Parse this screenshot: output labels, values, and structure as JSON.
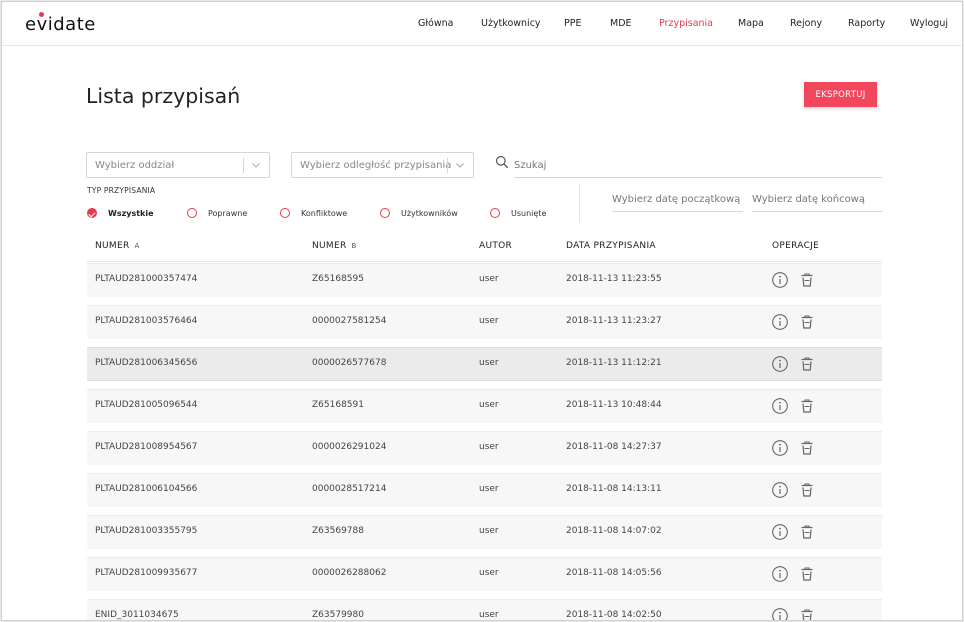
{
  "header": {
    "logo": "evidate",
    "nav": [
      {
        "label": "Główna",
        "active": false
      },
      {
        "label": "Użytkownicy",
        "active": false
      },
      {
        "label": "PPE",
        "active": false
      },
      {
        "label": "MDE",
        "active": false
      },
      {
        "label": "Przypisania",
        "active": true
      },
      {
        "label": "Mapa",
        "active": false
      },
      {
        "label": "Rejony",
        "active": false
      },
      {
        "label": "Raporty",
        "active": false
      },
      {
        "label": "Wyloguj",
        "active": false
      }
    ]
  },
  "page": {
    "title": "Lista przypisań",
    "export_label": "EKSPORTUJ"
  },
  "filters": {
    "branch_placeholder": "Wybierz oddział",
    "distance_placeholder": "Wybierz odległość przypisania",
    "search_placeholder": "Szukaj",
    "type_label": "TYP PRZYPISANIA",
    "types": [
      {
        "label": "Wszystkie",
        "checked": true
      },
      {
        "label": "Poprawne",
        "checked": false
      },
      {
        "label": "Konfliktowe",
        "checked": false
      },
      {
        "label": "Użytkowników",
        "checked": false
      },
      {
        "label": "Usunięte",
        "checked": false
      }
    ],
    "date_from_placeholder": "Wybierz datę początkową",
    "date_to_placeholder": "Wybierz datę końcową"
  },
  "table": {
    "columns": [
      {
        "label": "NUMER",
        "sort": "A"
      },
      {
        "label": "NUMER",
        "sort": "B"
      },
      {
        "label": "AUTOR",
        "sort": ""
      },
      {
        "label": "DATA PRZYPISANIA",
        "sort": ""
      },
      {
        "label": "OPERACJE",
        "sort": ""
      }
    ],
    "rows": [
      {
        "a": "PLTAUD281000357474",
        "b": "Z65168595",
        "author": "user",
        "date": "2018-11-13 11:23:55"
      },
      {
        "a": "PLTAUD281003576464",
        "b": "0000027581254",
        "author": "user",
        "date": "2018-11-13 11:23:27"
      },
      {
        "a": "PLTAUD281006345656",
        "b": "0000026577678",
        "author": "user",
        "date": "2018-11-13 11:12:21",
        "highlight": true
      },
      {
        "a": "PLTAUD281005096544",
        "b": "Z65168591",
        "author": "user",
        "date": "2018-11-13 10:48:44"
      },
      {
        "a": "PLTAUD281008954567",
        "b": "0000026291024",
        "author": "user",
        "date": "2018-11-08 14:27:37"
      },
      {
        "a": "PLTAUD281006104566",
        "b": "0000028517214",
        "author": "user",
        "date": "2018-11-08 14:13:11"
      },
      {
        "a": "PLTAUD281003355795",
        "b": "Z63569788",
        "author": "user",
        "date": "2018-11-08 14:07:02"
      },
      {
        "a": "PLTAUD281009935677",
        "b": "0000026288062",
        "author": "user",
        "date": "2018-11-08 14:05:56"
      },
      {
        "a": "ENID_3011034675",
        "b": "Z63579980",
        "author": "user",
        "date": "2018-11-08 14:02:50"
      }
    ]
  },
  "colors": {
    "accent": "#e8394d",
    "button": "#f0475c"
  }
}
